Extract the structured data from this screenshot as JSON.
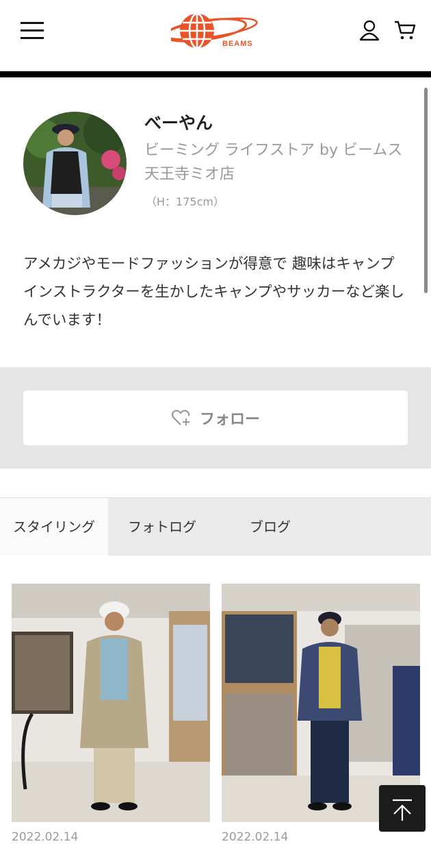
{
  "header": {
    "brand": "BEAMS",
    "menu_icon": "hamburger-menu-icon",
    "account_icon": "user-icon",
    "cart_icon": "shopping-cart-icon",
    "accent_color": "#e8542a"
  },
  "profile": {
    "name": "べーやん",
    "store": "ビーミング ライフストア by ビームス 天王寺ミオ店",
    "height": "（H：175cm）",
    "bio": "アメカジやモードファッションが得意で 趣味はキャンプインストラクターを生かしたキャンプやサッカーなど楽しんでいます！"
  },
  "follow": {
    "label": "フォロー",
    "icon": "heart-plus-icon"
  },
  "tabs": [
    {
      "label": "スタイリング",
      "active": true
    },
    {
      "label": "フォトログ",
      "active": false
    },
    {
      "label": "ブログ",
      "active": false
    }
  ],
  "posts": [
    {
      "date": "2022.02.14"
    },
    {
      "date": "2022.02.14"
    }
  ],
  "scroll_top_icon": "arrow-up-to-top-icon"
}
